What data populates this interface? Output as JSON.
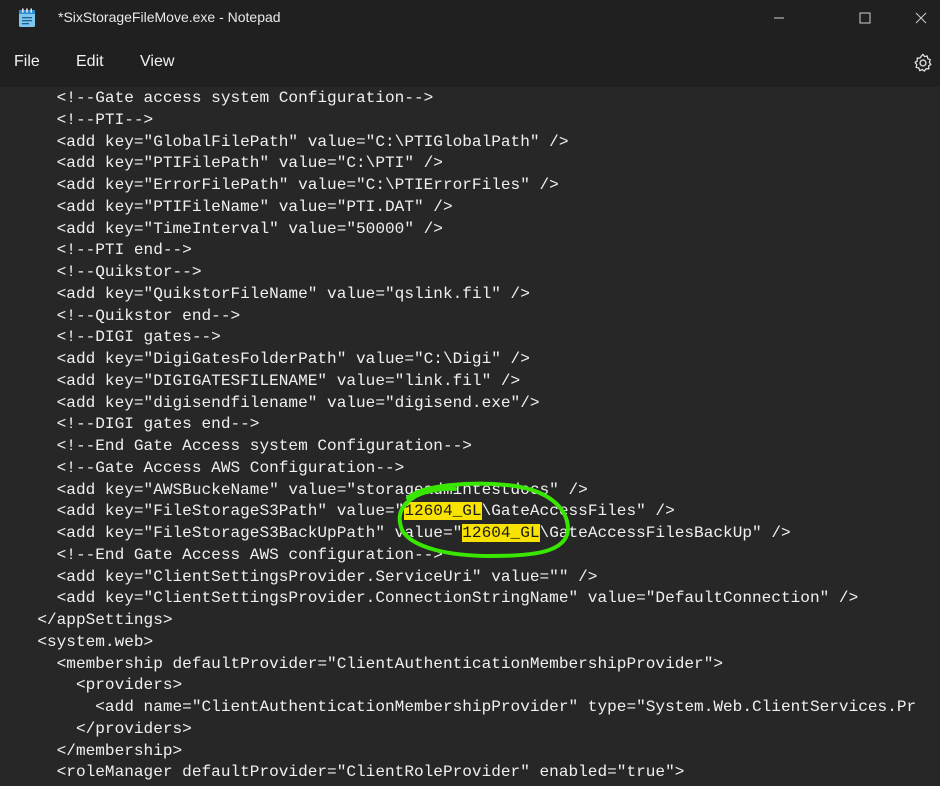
{
  "window": {
    "title": "*SixStorageFileMove.exe - Notepad",
    "minimize_glyph": "—",
    "maximize_glyph": "☐",
    "close_glyph": "✕"
  },
  "menu": {
    "file": "File",
    "edit": "Edit",
    "view": "View"
  },
  "editor": {
    "lines": [
      "    <!--Gate access system Configuration-->",
      "    <!--PTI-->",
      "    <add key=\"GlobalFilePath\" value=\"C:\\PTIGlobalPath\" />",
      "    <add key=\"PTIFilePath\" value=\"C:\\PTI\" />",
      "    <add key=\"ErrorFilePath\" value=\"C:\\PTIErrorFiles\" />",
      "    <add key=\"PTIFileName\" value=\"PTI.DAT\" />",
      "    <add key=\"TimeInterval\" value=\"50000\" />",
      "    <!--PTI end-->",
      "    <!--Quikstor-->",
      "    <add key=\"QuikstorFileName\" value=\"qslink.fil\" />",
      "    <!--Quikstor end-->",
      "    <!--DIGI gates-->",
      "    <add key=\"DigiGatesFolderPath\" value=\"C:\\Digi\" />",
      "    <add key=\"DIGIGATESFILENAME\" value=\"link.fil\" />",
      "    <add key=\"digisendfilename\" value=\"digisend.exe\"/>",
      "    <!--DIGI gates end-->",
      "    <!--End Gate Access system Configuration-->",
      "    <!--Gate Access AWS Configuration-->",
      "    <add key=\"AWSBuckeName\" value=\"storageadmintestdocs\" />",
      {
        "pre": "    <add key=\"FileStorageS3Path\" value=\"",
        "hl": "12604_GL",
        "post": "\\GateAccessFiles\" />"
      },
      {
        "pre": "    <add key=\"FileStorageS3BackUpPath\" value=\"",
        "hl": "12604_GL",
        "post": "\\GateAccessFilesBackUp\" />"
      },
      "    <!--End Gate Access AWS configuration-->",
      "    <add key=\"ClientSettingsProvider.ServiceUri\" value=\"\" />",
      "    <add key=\"ClientSettingsProvider.ConnectionStringName\" value=\"DefaultConnection\" />",
      "  </appSettings>",
      "  <system.web>",
      "    <membership defaultProvider=\"ClientAuthenticationMembershipProvider\">",
      "      <providers>",
      "        <add name=\"ClientAuthenticationMembershipProvider\" type=\"System.Web.ClientServices.Pr",
      "      </providers>",
      "    </membership>",
      "    <roleManager defaultProvider=\"ClientRoleProvider\" enabled=\"true\">"
    ]
  },
  "colors": {
    "background": "#272727",
    "text": "#f0f0f0",
    "highlight": "#f7e200",
    "annotation": "#39e600"
  },
  "icons": {
    "app": "notepad-icon",
    "settings": "gear-icon"
  }
}
